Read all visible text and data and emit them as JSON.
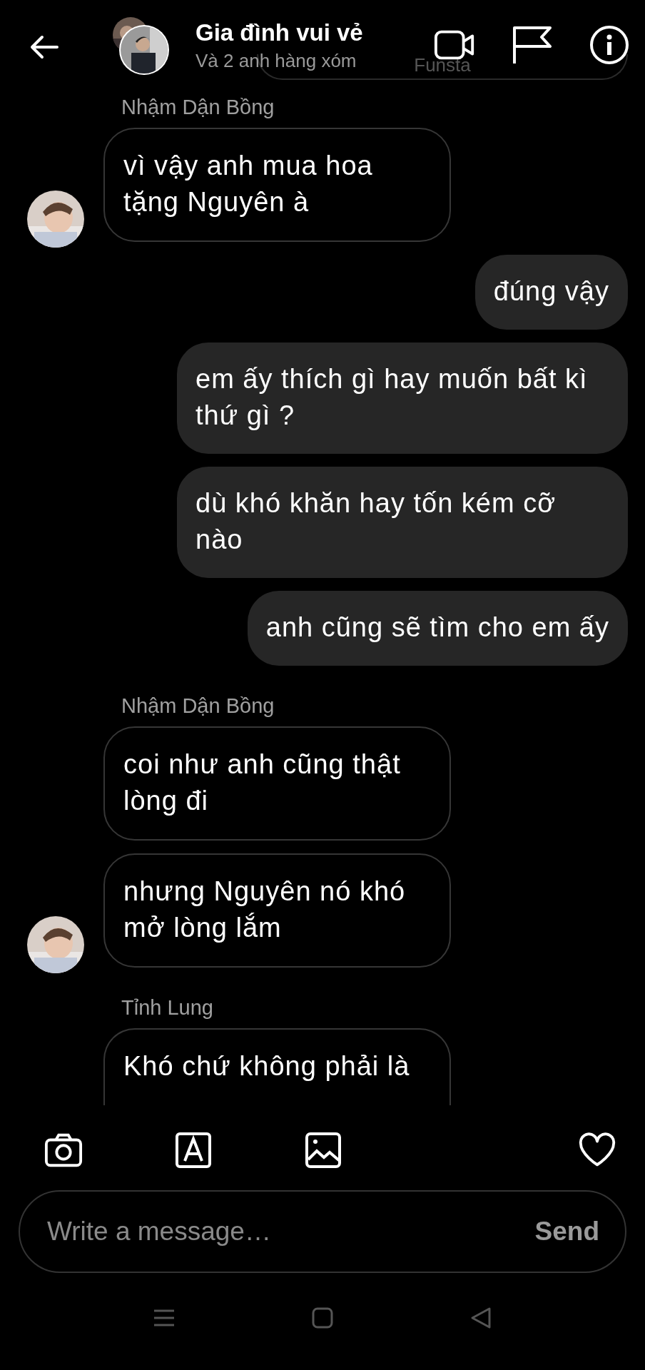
{
  "header": {
    "title": "Gia đình vui vẻ",
    "subtitle": "Và 2 anh hàng xóm"
  },
  "messages": [
    {
      "kind": "fragment",
      "text": "Funsta"
    },
    {
      "kind": "name",
      "text": "Nhậm Dận Bồng"
    },
    {
      "kind": "received",
      "text": "vì vậy anh mua hoa tặng Nguyên à",
      "avatar": true
    },
    {
      "kind": "sent",
      "text": "đúng vậy"
    },
    {
      "kind": "sent",
      "text": "em ấy thích gì hay muốn bất kì thứ gì ?"
    },
    {
      "kind": "sent",
      "text": "dù khó khăn hay tốn kém cỡ nào"
    },
    {
      "kind": "sent",
      "text": "anh cũng sẽ tìm cho em ấy"
    },
    {
      "kind": "name",
      "text": "Nhậm Dận Bồng"
    },
    {
      "kind": "received",
      "text": "coi như anh cũng thật lòng đi",
      "avatar": false
    },
    {
      "kind": "received",
      "text": "nhưng Nguyên nó khó mở lòng lắm",
      "avatar": true
    },
    {
      "kind": "name",
      "text": "Tỉnh Lung"
    },
    {
      "kind": "cut",
      "text": "Khó chứ không phải là"
    }
  ],
  "composer": {
    "placeholder": "Write a message…",
    "send": "Send"
  }
}
